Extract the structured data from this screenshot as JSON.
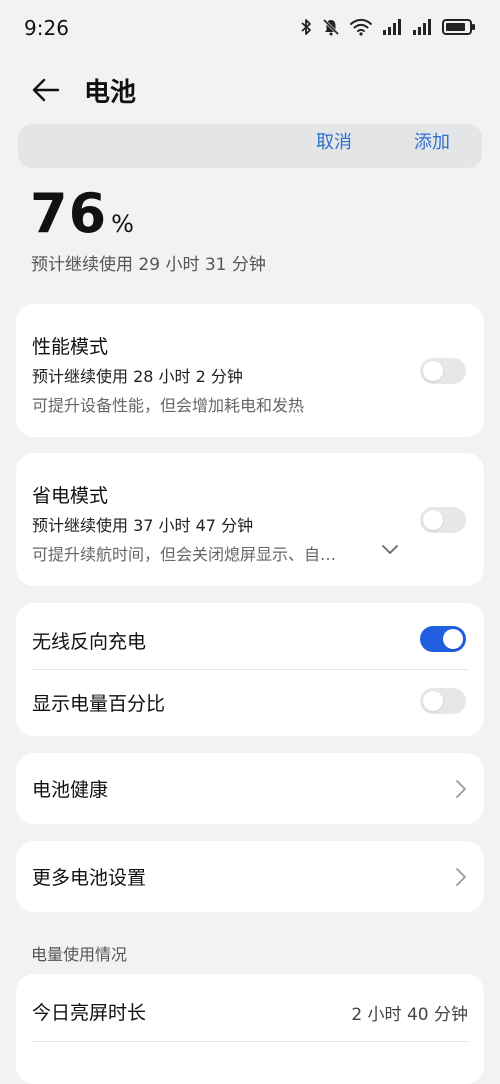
{
  "status_bar": {
    "time": "9:26"
  },
  "header": {
    "title": "电池"
  },
  "edit_bar": {
    "cancel_label": "取消",
    "add_label": "添加"
  },
  "battery": {
    "percent": "76",
    "unit": "%",
    "estimate": "预计继续使用 29 小时 31 分钟"
  },
  "performance_mode": {
    "title": "性能模式",
    "estimate": "预计继续使用 28 小时 2 分钟",
    "description": "可提升设备性能，但会增加耗电和发热",
    "enabled": false
  },
  "power_saving_mode": {
    "title": "省电模式",
    "estimate": "预计继续使用 37 小时 47 分钟",
    "description": "可提升续航时间，但会关闭熄屏显示、自…",
    "enabled": false
  },
  "wireless_reverse_charging": {
    "title": "无线反向充电",
    "enabled": true
  },
  "show_battery_percentage": {
    "title": "显示电量百分比",
    "enabled": false
  },
  "battery_health": {
    "title": "电池健康"
  },
  "more_battery_settings": {
    "title": "更多电池设置"
  },
  "usage_section": {
    "label": "电量使用情况",
    "screen_on_today_label": "今日亮屏时长",
    "screen_on_today_value": "2 小时 40 分钟"
  },
  "colors": {
    "accent": "#1f5fe0",
    "link": "#2f6fd1",
    "background": "#f1f3f3"
  }
}
